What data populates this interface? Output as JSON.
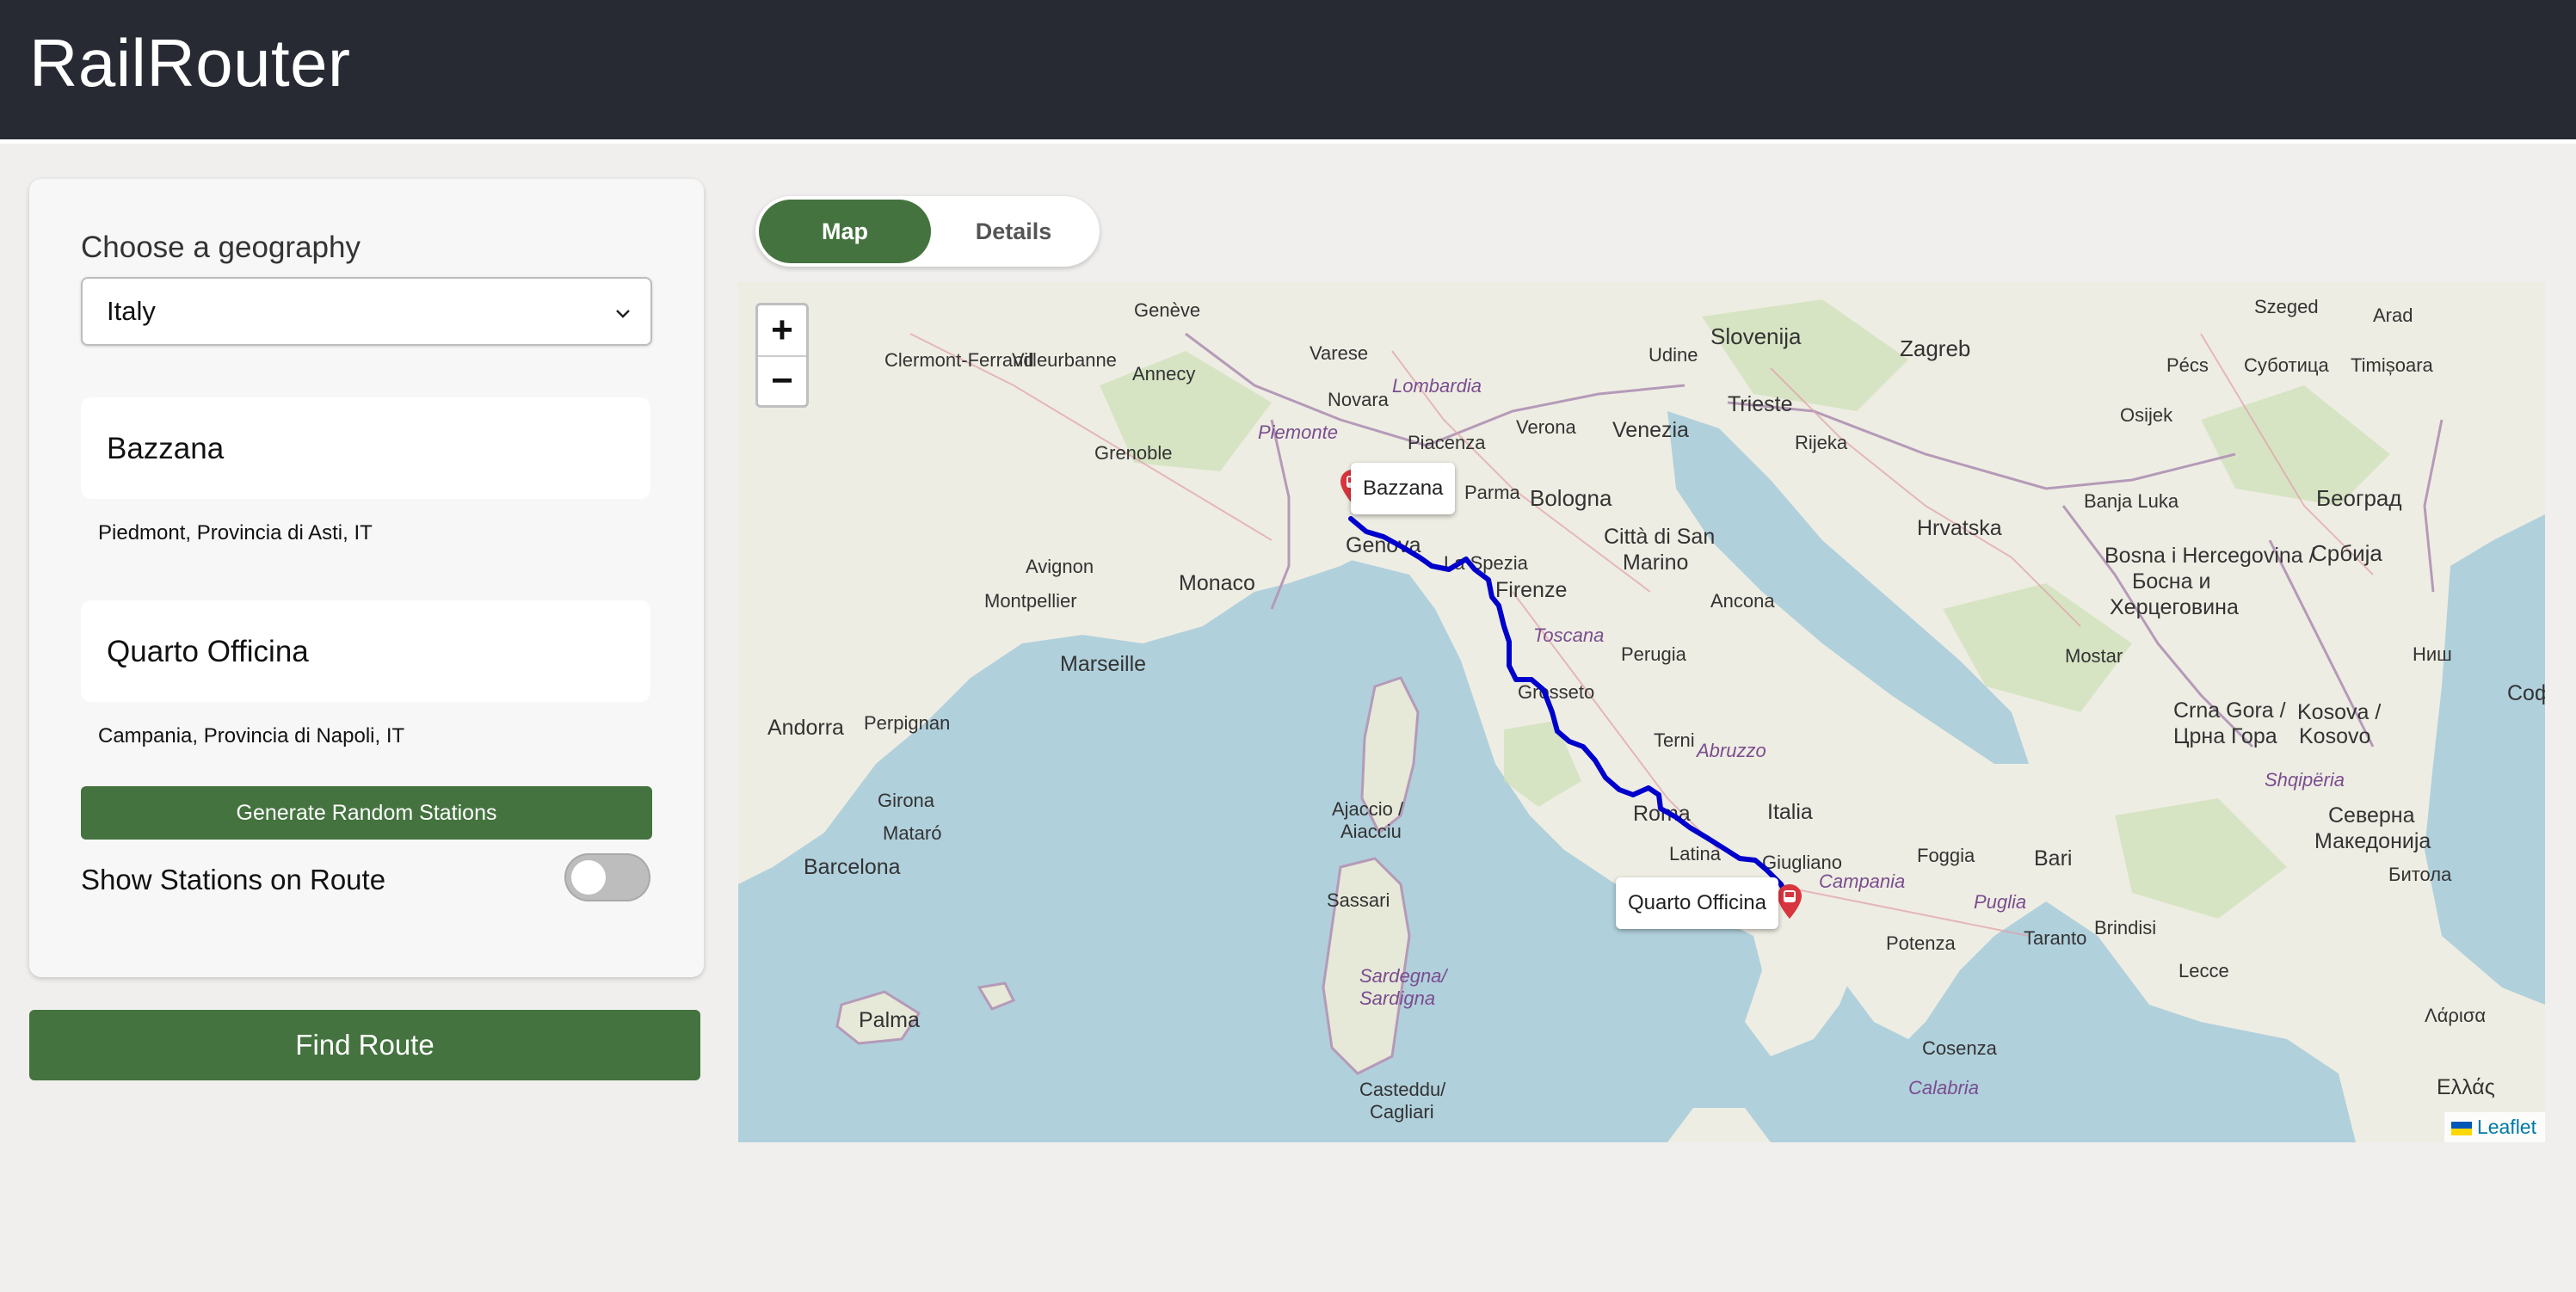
{
  "header": {
    "title": "RailRouter"
  },
  "sidebar": {
    "geography_label": "Choose a geography",
    "geography_selected": "Italy",
    "origin": {
      "name": "Bazzana",
      "region": "Piedmont, Provincia di Asti, IT"
    },
    "destination": {
      "name": "Quarto Officina",
      "region": "Campania, Provincia di Napoli, IT"
    },
    "generate_button": "Generate Random Stations",
    "show_stations_label": "Show Stations on Route",
    "show_stations_on": false,
    "find_route_button": "Find Route"
  },
  "tabs": [
    {
      "label": "Map",
      "active": true
    },
    {
      "label": "Details",
      "active": false
    }
  ],
  "map": {
    "zoom_in": "+",
    "zoom_out": "−",
    "origin_label": "Bazzana",
    "destination_label": "Quarto Officina",
    "attribution": "Leaflet",
    "route_color": "#0000cc",
    "marker_color": "#d9353f",
    "place_labels": {
      "slovenija": "Slovenija",
      "zagreb": "Zagreb",
      "szeged": "Szeged",
      "arad": "Arad",
      "pecs": "Pécs",
      "subotica": "Суботица",
      "timisoara": "Timișoara",
      "geneve": "Genève",
      "clermont": "Clermont-Ferrand",
      "villeurbanne": "Villeurbanne",
      "annecy": "Annecy",
      "grenoble": "Grenoble",
      "varese": "Varese",
      "novara": "Novara",
      "lombardia": "Lombardia",
      "piemonte": "Piemonte",
      "piacenza": "Piacenza",
      "parma": "Parma",
      "verona": "Verona",
      "venezia": "Venezia",
      "udine": "Udine",
      "trieste": "Trieste",
      "rijeka": "Rijeka",
      "bologna": "Bologna",
      "osijek": "Osijek",
      "beograd": "Београд",
      "banja_luka": "Banja Luka",
      "hrvatska": "Hrvatska",
      "bosna": "Bosna i Hercegovina /",
      "bosna2": "Босна и",
      "bosna3": "Херцеговина",
      "srbija": "Србија",
      "monaco": "Monaco",
      "genova": "Genova",
      "la_spezia": "La Spezia",
      "citta_san_marino": "Città di San",
      "marino": "Marino",
      "firenze": "Firenze",
      "ancona": "Ancona",
      "avignon": "Avignon",
      "montpellier": "Montpellier",
      "marseille": "Marseille",
      "toscana": "Toscana",
      "perugia": "Perugia",
      "grosseto": "Grosseto",
      "mostar": "Mostar",
      "crna_gora": "Crna Gora /",
      "crna_gora2": "Црна Гора",
      "kosova": "Kosova /",
      "kosovo": "Kosovo",
      "andorra": "Andorra",
      "perpignan": "Perpignan",
      "terni": "Terni",
      "abruzzo": "Abruzzo",
      "roma": "Roma",
      "italia": "Italia",
      "latina": "Latina",
      "giugliano": "Giugliano",
      "campania": "Campania",
      "foggia": "Foggia",
      "bari": "Bari",
      "shqiperia": "Shqipëria",
      "severna": "Северна",
      "makedonija": "Македонија",
      "girona": "Girona",
      "barcelona": "Barcelona",
      "mataro": "Mataró",
      "ajaccio": "Ajaccio /",
      "aiacciu": "Aiacciu",
      "sassari": "Sassari",
      "sardegna": "Sardegna/",
      "sardigna": "Sardigna",
      "potenza": "Potenza",
      "puglia": "Puglia",
      "taranto": "Taranto",
      "brindisi": "Brindisi",
      "lecce": "Lecce",
      "palma": "Palma",
      "cosenza": "Cosenza",
      "calabria": "Calabria",
      "cagliari": "Casteddu/",
      "cagliari2": "Cagliari",
      "ellas": "Ελλάς",
      "sofia": "София",
      "nis": "Ниш",
      "bitola": "Битола",
      "larisa": "Λάρισα"
    }
  }
}
